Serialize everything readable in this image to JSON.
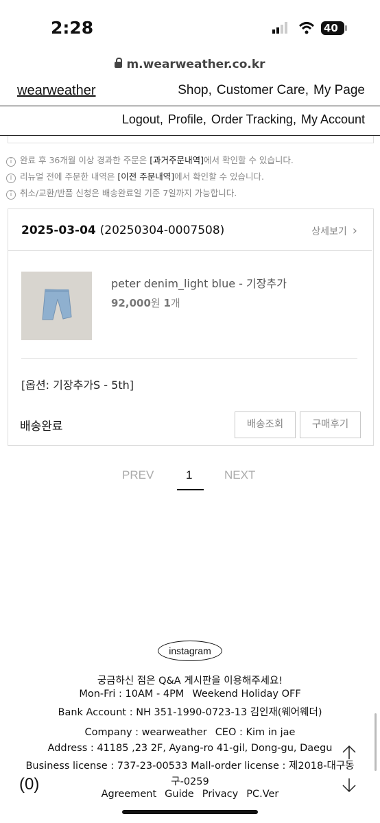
{
  "status_bar": {
    "time": "2:28",
    "battery": "40"
  },
  "browser": {
    "url": "m.wearweather.co.kr"
  },
  "header": {
    "logo": "wearweather",
    "top_nav": [
      "Shop,",
      "Customer Care,",
      "My Page"
    ],
    "sub_nav": [
      "Logout,",
      "Profile,",
      "Order Tracking,",
      "My Account"
    ]
  },
  "notices": [
    {
      "pre": "완료 후 36개월 이상 경과한 주문은 ",
      "link": "[과거주문내역]",
      "post": "에서 확인할 수 있습니다."
    },
    {
      "pre": "리뉴얼 전에 주문한 내역은 ",
      "link": "[이전 주문내역]",
      "post": "에서 확인할 수 있습니다."
    },
    {
      "pre": "취소/교환/반품 신청은 배송완료일 기준 7일까지 가능합니다.",
      "link": "",
      "post": ""
    }
  ],
  "order": {
    "date": "2025-03-04",
    "number": "(20250304-0007508)",
    "detail_label": "상세보기",
    "product_name": "peter denim_light blue - 기장추가",
    "price": "92,000",
    "price_unit": "원",
    "qty": "1",
    "qty_unit": "개",
    "option": "[옵션: 기장추가S - 5th]",
    "status": "배송완료",
    "btn_tracking": "배송조회",
    "btn_review": "구매후기"
  },
  "pagination": {
    "prev": "PREV",
    "current": "1",
    "next": "NEXT"
  },
  "footer": {
    "instagram": "instagram",
    "qa": "궁금하신 점은 Q&A 게시판을 이용해주세요!",
    "hours": "Mon-Fri : 10AM - 4PM",
    "holiday": "Weekend Holiday OFF",
    "bank": "Bank Account : NH 351-1990-0723-13  김인재(웨어웨더)",
    "company": "Company : wearweather",
    "ceo": "CEO : Kim in jae",
    "address": "Address : 41185 ,23 2F, Ayang-ro 41-gil, Dong-gu, Daegu",
    "license": "Business license : 737-23-00533   Mall-order license : 제2018-대구동",
    "license_cont": "구-0259",
    "links": [
      "Agreement",
      "Guide",
      "Privacy",
      "PC.Ver"
    ],
    "cart_count": "(0)"
  }
}
